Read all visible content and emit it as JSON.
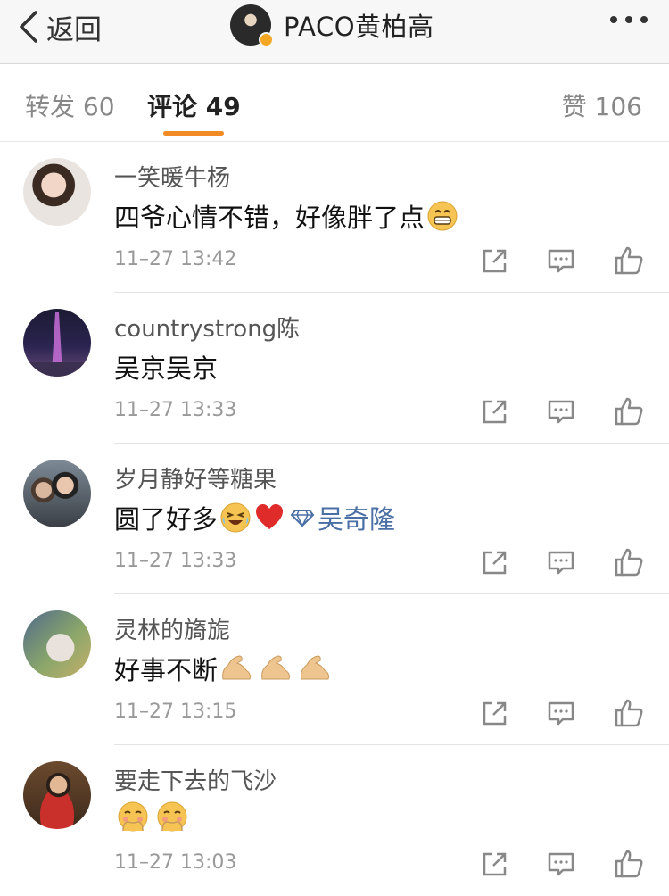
{
  "navbar": {
    "back_label": "返回",
    "title": "PACO黄柏高",
    "icons": {
      "back": "chevron-left-icon",
      "more": "more-dots-icon",
      "verified": "verified-badge-icon"
    }
  },
  "tabs": {
    "forward": "转发 60",
    "comments": "评论 49",
    "likes": "赞 106",
    "active": "comments",
    "accent_color": "#f08a24"
  },
  "comments": [
    {
      "user": "一笑暖牛杨",
      "text": "四爷心情不错，好像胖了点",
      "emojis": [
        "grin"
      ],
      "time": "11–27 13:42"
    },
    {
      "user": "countrystrong陈",
      "text": "吴京吴京",
      "emojis": [],
      "time": "11–27 13:33"
    },
    {
      "user": "岁月静好等糖果",
      "text": "圆了好多",
      "emojis": [
        "laugh-cry",
        "heart"
      ],
      "mention": "吴奇隆",
      "time": "11–27 13:33"
    },
    {
      "user": "灵林的旖旎",
      "text": "好事不断",
      "emojis": [
        "muscle",
        "muscle",
        "muscle"
      ],
      "time": "11–27 13:15"
    },
    {
      "user": "要走下去的飞沙",
      "text": "",
      "emojis": [
        "blush",
        "blush"
      ],
      "time": "11–27 13:03"
    }
  ],
  "colors": {
    "mention": "#4a6fa5",
    "meta_text": "#999999",
    "username": "#555555"
  }
}
